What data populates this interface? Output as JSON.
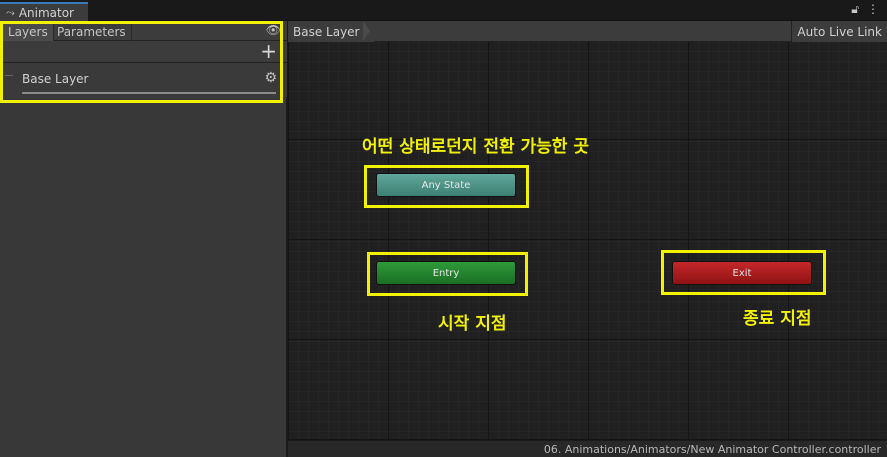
{
  "window": {
    "tab_title": "Animator"
  },
  "left_panel": {
    "tabs": [
      "Layers",
      "Parameters"
    ],
    "layers": [
      {
        "name": "Base Layer"
      }
    ]
  },
  "graph": {
    "breadcrumb": "Base Layer",
    "auto_live_link": "Auto Live Link",
    "states": {
      "any_state": "Any State",
      "entry": "Entry",
      "exit": "Exit"
    },
    "colors": {
      "any_state": "#4a9487",
      "entry": "#23852e",
      "exit": "#a81c1e",
      "highlight": "#f2f200"
    }
  },
  "annotations": {
    "any_state_note": "어떤 상태로던지 전환 가능한 곳",
    "entry_note": "시작 지점",
    "exit_note": "종료 지점"
  },
  "status": {
    "path": "06. Animations/Animators/New Animator Controller.controller"
  },
  "icons": [
    "animator-tab-icon",
    "lock-icon",
    "menu-dots-icon",
    "eye-icon",
    "add-icon",
    "gear-icon"
  ]
}
